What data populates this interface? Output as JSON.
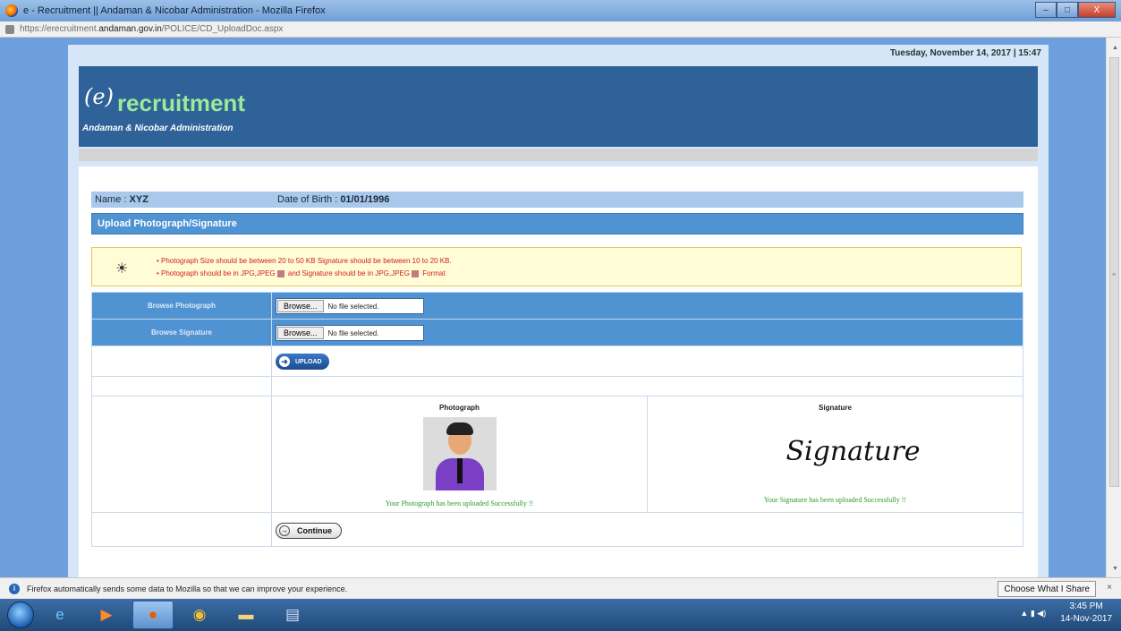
{
  "window": {
    "title": "e - Recruitment || Andaman & Nicobar Administration - Mozilla Firefox",
    "url_prefix": "https://erecruitment.",
    "url_domain": "andaman.gov.in",
    "url_path": "/POLICE/CD_UploadDoc.aspx",
    "min": "‒",
    "max": "□",
    "close": "X"
  },
  "page": {
    "datestamp": "Tuesday, November 14, 2017 | 15:47",
    "logo_e": "(e)",
    "logo_text": "recruitment",
    "logo_sub": "Andaman & Nicobar Administration"
  },
  "candidate": {
    "name_label": "Name : ",
    "name_value": "XYZ",
    "dob_label": "Date of Birth : ",
    "dob_value": "01/01/1996"
  },
  "section": {
    "title": "Upload Photograph/Signature"
  },
  "notice": {
    "icon": "sun-icon",
    "line1": "• Photograph Size should be between 20 to 50 KB Signature should be between 10 to 20 KB.",
    "line2_a": "• Photograph should be in JPG,JPEG",
    "line2_b": "and Signature should be in JPG,JPEG",
    "line2_c": "Format"
  },
  "form": {
    "photo_label": "Browse Photograph",
    "sig_label": "Browse Signature",
    "browse_label": "Browse...",
    "photo_status": "No file selected.",
    "sig_status": "No file selected.",
    "upload_label": "UPLOAD",
    "continue_label": "Continue"
  },
  "preview": {
    "photo_caption": "Photograph",
    "sig_caption": "Signature",
    "sig_image_text": "Signature",
    "photo_success": "Your Photograph has been uploaded Successfully !!",
    "sig_success": "Your Signature has been uploaded Successfully !!"
  },
  "notification": {
    "message": "Firefox automatically sends some data to Mozilla so that we can improve your experience.",
    "button": "Choose What I Share",
    "close": "×"
  },
  "taskbar": {
    "time": "3:45 PM",
    "date": "14-Nov-2017"
  }
}
